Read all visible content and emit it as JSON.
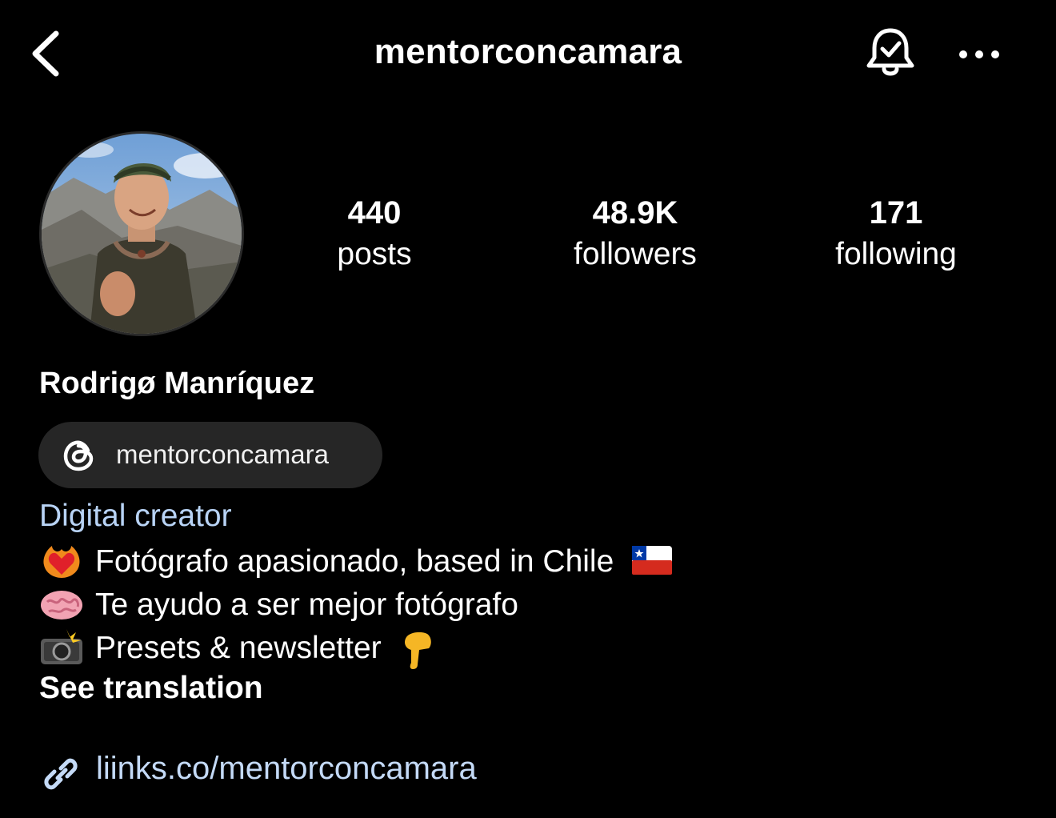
{
  "header": {
    "username": "mentorconcamara",
    "back_icon": "chevron-left-icon",
    "bell_icon": "bell-check-icon",
    "more_icon": "more-horizontal-icon"
  },
  "profile": {
    "avatar_icon": "profile-photo",
    "stats": {
      "posts_count": "440",
      "posts_label": "posts",
      "followers_count": "48.9K",
      "followers_label": "followers",
      "following_count": "171",
      "following_label": "following"
    },
    "display_name": "Rodrigø Manríquez",
    "threads_badge": {
      "icon": "threads-icon",
      "label": "mentorconcamara"
    },
    "category": "Digital creator",
    "bio_lines": [
      {
        "emoji": "heart-on-fire-emoji",
        "text": "Fotógrafo apasionado, based in Chile",
        "trailing_emoji": "chile-flag-emoji"
      },
      {
        "emoji": "brain-emoji",
        "text": "Te ayudo a ser mejor fotógrafo"
      },
      {
        "emoji": "camera-flash-emoji",
        "text": "Presets & newsletter",
        "trailing_emoji": "pointing-down-emoji"
      }
    ],
    "see_translation": "See translation",
    "link": {
      "icon": "link-icon",
      "text": "liinks.co/mentorconcamara"
    }
  },
  "colors": {
    "background": "#000000",
    "text": "#ffffff",
    "link": "#c4daf7",
    "category": "#b8d3f5",
    "pill": "#262626"
  }
}
